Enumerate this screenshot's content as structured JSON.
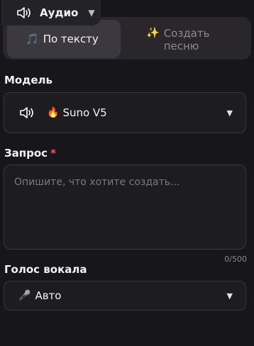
{
  "header": {
    "mode_label": "Аудио",
    "mode_icon": "speaker-icon"
  },
  "tabs": [
    {
      "label": "По тексту",
      "icon": "musical-note-icon",
      "active": true
    },
    {
      "label": "Создать песню",
      "icon": "sparkles-icon",
      "active": false
    }
  ],
  "model": {
    "label": "Модель",
    "value": "Suno V5",
    "icon": "speaker-icon",
    "badge_icon": "fire-icon"
  },
  "prompt": {
    "label": "Запрос",
    "required_mark": "*",
    "placeholder": "Опишите, что хотите создать...",
    "value": "",
    "counter": "0/500"
  },
  "voice": {
    "label": "Голос вокала",
    "value": "Авто",
    "icon": "microphone-icon"
  },
  "colors": {
    "background": "#17161a",
    "required": "#ff4d5e",
    "active_tab": "#3b393f"
  }
}
